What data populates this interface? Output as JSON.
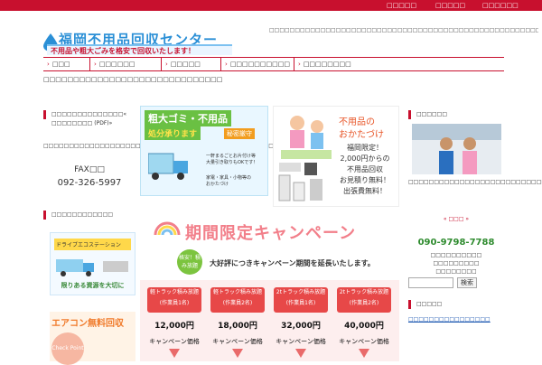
{
  "colors": {
    "brand": "#c8102e",
    "accent": "#2a8fd6",
    "pink": "#f27f8a"
  },
  "topbar": {
    "links": [
      "□□□□□",
      "□□□□□",
      "□□□□□□"
    ]
  },
  "logo": {
    "title": "福岡不用品回収センター",
    "subtitle": "不用品や粗大ごみを格安で回収いたします！"
  },
  "header_desc": "□□□□□□□□□□□□□□□□□□□□□□□□□□□□□□□□□□□□□□□□□□□□□□□□□□□□□□□□□□□□□□□□□□□□□□□□□□□□□□□□□□□□□□□□□□□□□□□□□□□□□□□□□□□□□□□□□□□□□□□□□",
  "nav": {
    "items": [
      "□□□",
      "□□□□□□",
      "□□□□□",
      "□□□□□□□□□□",
      "□□□□□□□□"
    ]
  },
  "notice": "□□□□□□□□□□□□□□□□□□□□□□□□□□□□□□",
  "left": {
    "box1_title": "□□□□□□□□□□□□□□« □□□□□□□□ (PDF)»",
    "box1_text": "□□□□□□□□□□□□□□□□□□□□□□□□□□□□□□□FAX□□□□□□□□□□□□",
    "fax_label": "FAX□□",
    "fax_number": "092-326-5997",
    "box2_title": "□□□□□□□□□□□□",
    "ad1_text": "ドライブエコステーション",
    "ad1_caption": "限りある資源を大切に",
    "ad2_text": "エアコン無料回収",
    "ad2_sub": "Check Point"
  },
  "main": {
    "banner1_title": "粗大ゴミ・不用品",
    "banner1_sub": "処分承ります",
    "banner1_tag": "秘密厳守",
    "banner1_line1": "一軒まるごとお片付け等",
    "banner1_line2": "大量引き取りもOKです！",
    "banner1_line3": "家電・家具・小物等の",
    "banner1_line4": "おかたづけ",
    "banner2_title1": "不用品の",
    "banner2_title2": "おかたづけ",
    "banner2_lines": [
      "福岡限定！",
      "2,000円からの",
      "不用品回収",
      "お見積り無料！",
      "出張費無料！"
    ],
    "campaign_title": "期間限定キャンペーン",
    "campaign_badge": "格安！積み放題",
    "campaign_sub": "大好評につきキャンペーン期間を延長いたします。",
    "plans": [
      {
        "name": "軽トラック積み放題",
        "staff": "(作業員1名)",
        "price": "12,000円",
        "caption": "キャンペーン価格"
      },
      {
        "name": "軽トラック積み放題",
        "staff": "(作業員2名)",
        "price": "18,000円",
        "caption": "キャンペーン価格"
      },
      {
        "name": "2tトラック積み放題",
        "staff": "(作業員1名)",
        "price": "32,000円",
        "caption": "キャンペーン価格"
      },
      {
        "name": "2tトラック積み放題",
        "staff": "(作業員2名)",
        "price": "40,000円",
        "caption": "キャンペーン価格"
      }
    ]
  },
  "right": {
    "box1_title": "□□□□□□",
    "box1_text": "□□□□□□□□□□□□□□□□□□□□□□□□□□□□□□□",
    "contact_label": "« □□□ »",
    "phone": "090-9798-7788",
    "contact_lines": [
      "□□□□□□□□□□",
      "□□□□□□□□□",
      "□□□□□□□□"
    ],
    "search_placeholder": "",
    "search_button": "検索",
    "box3_title": "□□□□□",
    "link1": "□□□□□□□□□□□□□□□□"
  }
}
